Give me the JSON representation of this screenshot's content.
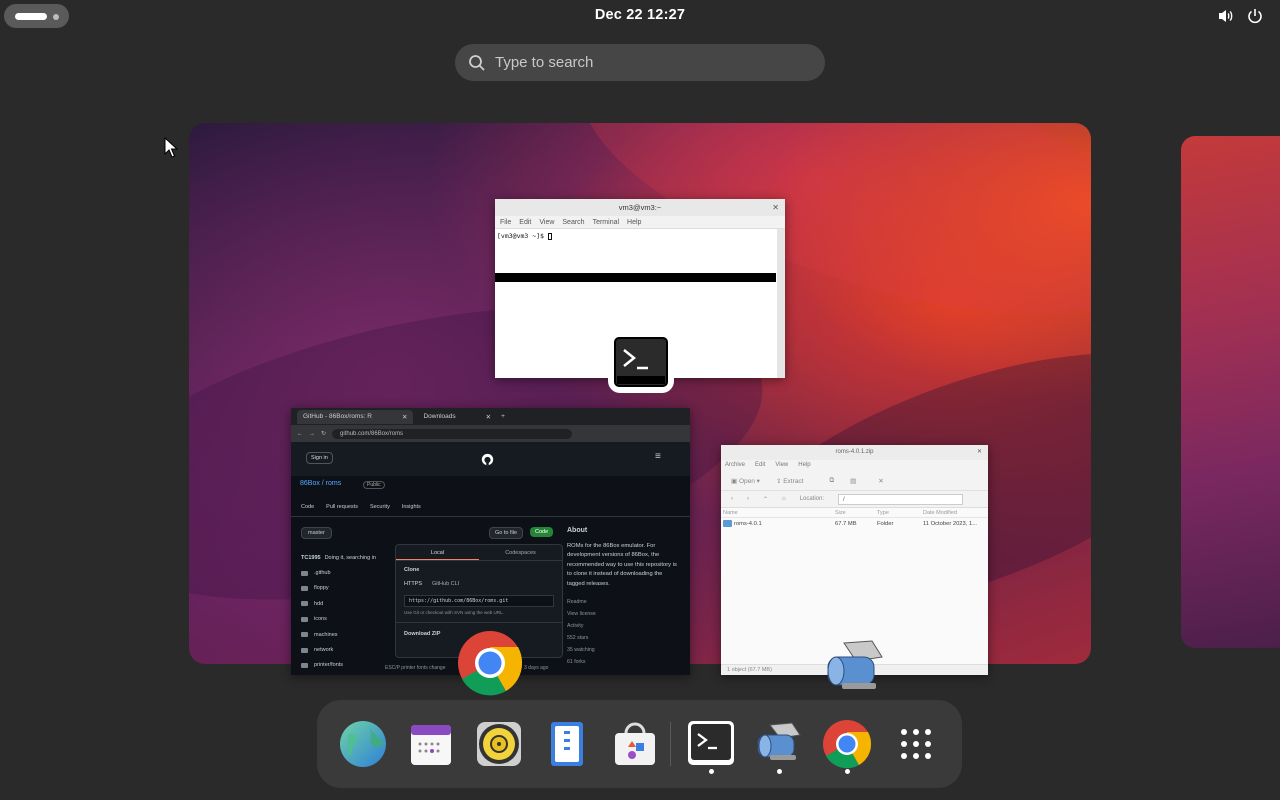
{
  "topbar": {
    "clock": "Dec 22  12:27",
    "icons": [
      "volume-icon",
      "power-icon"
    ]
  },
  "search": {
    "placeholder": "Type to search"
  },
  "windows": {
    "terminal": {
      "title": "vm3@vm3:~",
      "menu": [
        "File",
        "Edit",
        "View",
        "Search",
        "Terminal",
        "Help"
      ],
      "prompt": "[vm3@vm3 ~]$ "
    },
    "browser": {
      "tabs": [
        "GitHub - 86Box/roms: R",
        "Downloads"
      ],
      "url": "github.com/86Box/roms",
      "signin": "Sign in",
      "repo": "86Box / roms",
      "visibility": "Public",
      "repo_tabs": [
        "Code",
        "Pull requests",
        "Security",
        "Insights"
      ],
      "branch": "master",
      "go_to_file": "Go to file",
      "code_button": "Code",
      "commit_author": "TC1995",
      "commit_msg": "Doing it, searching in",
      "files": [
        ".github",
        "floppy",
        "hdd",
        "icons",
        "machines",
        "network",
        "printer/fonts"
      ],
      "dropdown": {
        "tabs": [
          "Local",
          "Codespaces"
        ],
        "clone": "Clone",
        "protocols": [
          "HTTPS",
          "GitHub CLI"
        ],
        "clone_url": "https://github.com/86Box/roms.git",
        "hint": "Use Git or checkout with SVN using the web URL.",
        "download": "Download ZIP"
      },
      "about": {
        "heading": "About",
        "text": "ROMs for the 86Box emulator. For development versions of 86Box, the recommended way to use this repository is to clone it instead of downloading the tagged releases.",
        "meta": [
          "Readme",
          "View license",
          "Activity",
          "552 stars",
          "35 watching",
          "61 forks"
        ]
      },
      "last_row_note": "ESC/P printer fonts change",
      "last_row_time": "3 days ago"
    },
    "archive": {
      "title": "roms-4.0.1.zip",
      "menu": [
        "Archive",
        "Edit",
        "View",
        "Help"
      ],
      "toolbar": [
        "Open",
        "Extract"
      ],
      "location_label": "Location:",
      "location": "/",
      "columns": [
        "Name",
        "Size",
        "Type",
        "Date Modified"
      ],
      "row": {
        "name": "roms-4.0.1",
        "size": "67.7 MB",
        "type": "Folder",
        "date": "11 October 2023, 1..."
      },
      "status": "1 object (67.7 MB)"
    }
  },
  "dash": {
    "apps": [
      {
        "name": "browser-globe-icon",
        "running": false
      },
      {
        "name": "calendar-icon",
        "running": false
      },
      {
        "name": "music-player-icon",
        "running": false
      },
      {
        "name": "text-editor-icon",
        "running": false
      },
      {
        "name": "software-store-icon",
        "running": false
      },
      {
        "name": "terminal-icon",
        "running": true
      },
      {
        "name": "archive-manager-icon",
        "running": true
      },
      {
        "name": "chrome-icon",
        "running": true
      },
      {
        "name": "app-grid-icon",
        "running": false
      }
    ]
  }
}
